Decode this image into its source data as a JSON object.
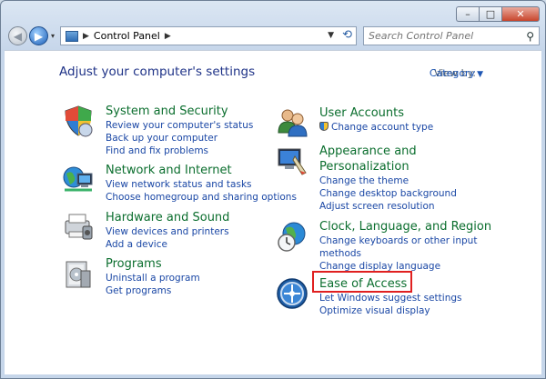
{
  "window": {
    "minimize_glyph": "–",
    "maximize_glyph": "□",
    "close_glyph": "✕"
  },
  "nav": {
    "back_glyph": "◀",
    "forward_glyph": "▶",
    "history_glyph": "▾",
    "address_sep_glyph": "▶",
    "address_text": "Control Panel",
    "address_after_glyph": "▶",
    "address_drop_glyph": "▼",
    "refresh_glyph": "⟲",
    "search_placeholder": "Search Control Panel",
    "search_icon_glyph": "⚲"
  },
  "page": {
    "title": "Adjust your computer's settings",
    "view_by_label": "View by:",
    "view_by_value": "Category",
    "view_by_arrow": "▼"
  },
  "categories": {
    "system": {
      "heading": "System and Security",
      "links": [
        "Review your computer's status",
        "Back up your computer",
        "Find and fix problems"
      ]
    },
    "network": {
      "heading": "Network and Internet",
      "links": [
        "View network status and tasks",
        "Choose homegroup and sharing options"
      ]
    },
    "hardware": {
      "heading": "Hardware and Sound",
      "links": [
        "View devices and printers",
        "Add a device"
      ]
    },
    "programs": {
      "heading": "Programs",
      "links": [
        "Uninstall a program",
        "Get programs"
      ]
    },
    "users": {
      "heading": "User Accounts",
      "links": [
        "Change account type"
      ]
    },
    "appearance": {
      "heading_line1": "Appearance and",
      "heading_line2": "Personalization",
      "links": [
        "Change the theme",
        "Change desktop background",
        "Adjust screen resolution"
      ]
    },
    "clock": {
      "heading": "Clock, Language, and Region",
      "links": [
        "Change keyboards or other input",
        "methods",
        "Change display language"
      ]
    },
    "ease": {
      "heading": "Ease of Access",
      "links": [
        "Let Windows suggest settings",
        "Optimize visual display"
      ]
    }
  },
  "colors": {
    "heading_green": "#0b6e2e",
    "link_blue": "#1a47a5",
    "title_blue": "#1e3287",
    "highlight_red": "#e02020"
  }
}
